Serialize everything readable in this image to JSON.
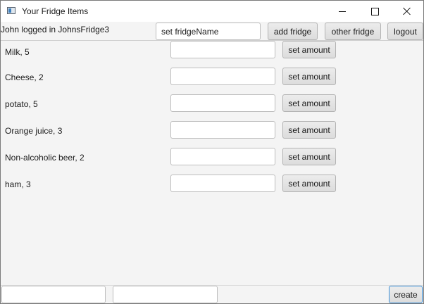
{
  "window": {
    "title": "Your Fridge Items"
  },
  "toolbar": {
    "status": "John logged in JohnsFridge3",
    "fridge_name_value": "set fridgeName",
    "add_fridge_label": "add fridge",
    "other_fridge_label": "other fridge",
    "logout_label": "logout"
  },
  "items": [
    {
      "label": "Milk, 5",
      "amount_value": "",
      "button_label": "set amount"
    },
    {
      "label": "Cheese, 2",
      "amount_value": "",
      "button_label": "set amount"
    },
    {
      "label": "potato, 5",
      "amount_value": "",
      "button_label": "set amount"
    },
    {
      "label": "Orange juice, 3",
      "amount_value": "",
      "button_label": "set amount"
    },
    {
      "label": "Non-alcoholic beer, 2",
      "amount_value": "",
      "button_label": "set amount"
    },
    {
      "label": "ham, 3",
      "amount_value": "",
      "button_label": "set amount"
    }
  ],
  "footer": {
    "name_value": "",
    "amount_value": "",
    "create_label": "create"
  },
  "icons": {
    "app": "app-window-icon",
    "minimize": "minimize-icon",
    "maximize": "maximize-icon",
    "close": "close-icon"
  }
}
